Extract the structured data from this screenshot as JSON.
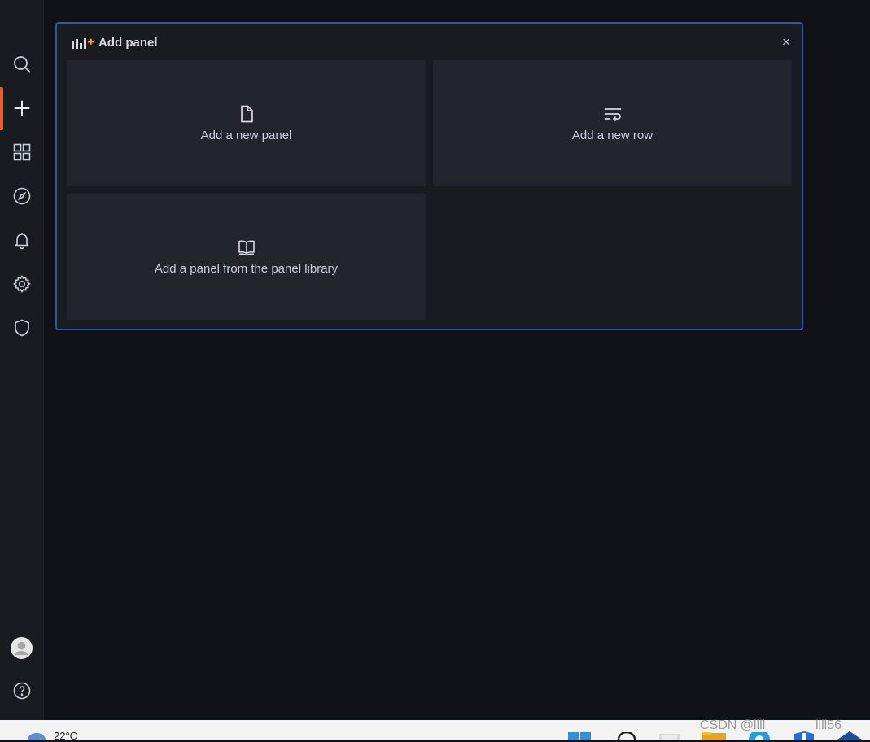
{
  "sidebar": {
    "items": [
      {
        "icon": "search-icon"
      },
      {
        "icon": "plus-icon"
      },
      {
        "icon": "dashboards-grid-icon"
      },
      {
        "icon": "compass-icon"
      },
      {
        "icon": "bell-icon"
      },
      {
        "icon": "gear-icon"
      },
      {
        "icon": "shield-icon"
      }
    ],
    "bottom": [
      {
        "icon": "avatar"
      },
      {
        "icon": "help-icon"
      }
    ],
    "active_color": "#f05a28"
  },
  "add_panel": {
    "title": "Add panel",
    "close_label": "×",
    "border_color": "#2e56ad",
    "tiles": [
      {
        "label": "Add a new panel",
        "icon": "file-icon"
      },
      {
        "label": "Add a new row",
        "icon": "row-wrap-icon"
      },
      {
        "label": "Add a panel from the panel library",
        "icon": "book-open-icon"
      }
    ]
  },
  "taskbar": {
    "weather": "22°C",
    "watermark_left": "CSDN @llll",
    "watermark_right": "llll56"
  }
}
